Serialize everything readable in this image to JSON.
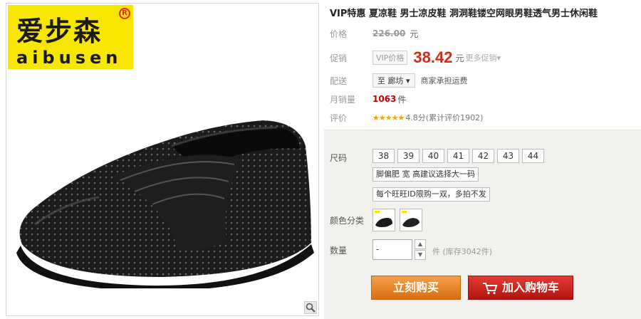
{
  "logo": {
    "cn": "爱步森",
    "en": "aibusen",
    "reg": "R"
  },
  "product": {
    "title": "VIP特惠 夏凉鞋 男士凉皮鞋 洞洞鞋镂空网眼男鞋透气男士休闲鞋"
  },
  "pricing": {
    "price_label": "价格",
    "original_price": "226.00",
    "currency": "元",
    "promo_label": "促销",
    "vip_tag": "VIP价格",
    "current_price": "38.42",
    "more_promos": "更多促销▾"
  },
  "shipping": {
    "label": "配送",
    "destination": "至 廊坊 ▾",
    "note": "商家承担运费"
  },
  "sales": {
    "label": "月销量",
    "count": "1063",
    "unit": "件"
  },
  "rating": {
    "label": "评价",
    "stars": "★★★★★",
    "text": "4.8分(累计评价1902)",
    "value": 4.8
  },
  "options": {
    "size_label": "尺码",
    "sizes": [
      "38",
      "39",
      "40",
      "41",
      "42",
      "43",
      "44"
    ],
    "size_tip": "脚偏肥 宽 高建议选择大一码",
    "limit_tip": "每个旺旺ID限购一双，多拍不发",
    "color_label": "颜色分类",
    "quantity_label": "数量",
    "quantity_value": "-",
    "stock_text": "件 (库存3042件)",
    "step_up": "▲",
    "step_down": "▼"
  },
  "actions": {
    "buy_now": "立刻购买",
    "add_to_cart": "加入购物车"
  },
  "colors": {
    "price_red": "#d22a18",
    "buy_orange": "#d66f12",
    "cart_red": "#b2140f",
    "star_gold": "#f0a30a",
    "logo_yellow": "#f7e600"
  }
}
